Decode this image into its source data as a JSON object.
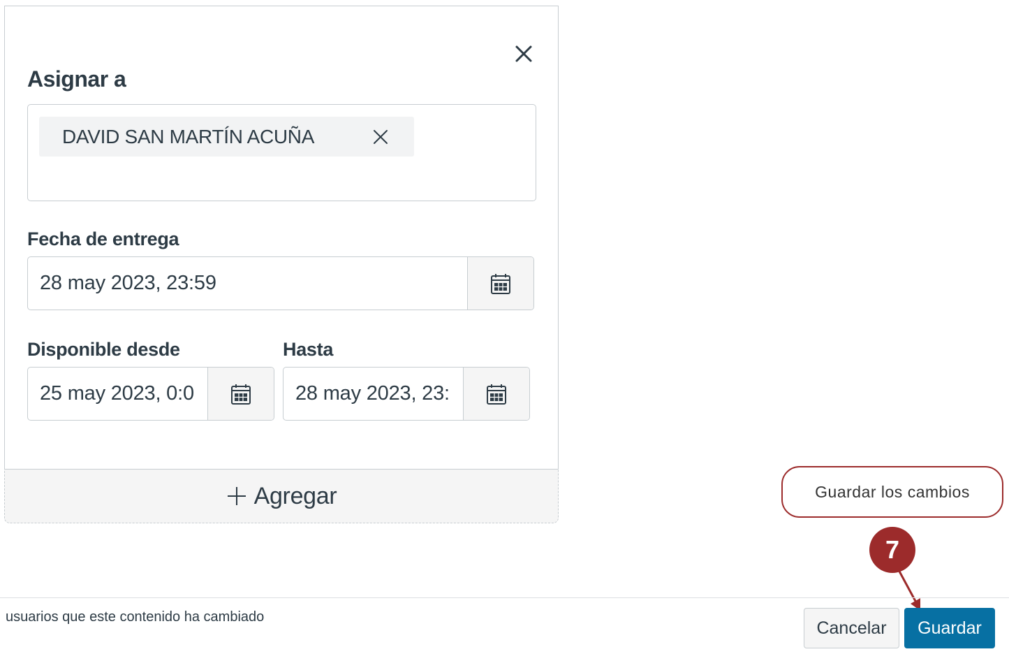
{
  "panel": {
    "title": "Asignar a",
    "assignees": [
      {
        "name": "DAVID SAN MARTÍN ACUÑA"
      }
    ],
    "due": {
      "label": "Fecha de entrega",
      "value": "28 may 2023, 23:59"
    },
    "available_from": {
      "label": "Disponible desde",
      "value": "25 may 2023, 0:0"
    },
    "until": {
      "label": "Hasta",
      "value": "28 may 2023, 23:"
    },
    "add_label": "Agregar"
  },
  "callout": {
    "text": "Guardar los cambios",
    "step": "7",
    "color": "#9c2b2b"
  },
  "footer": {
    "note": "usuarios que este contenido ha cambiado",
    "cancel_label": "Cancelar",
    "save_label": "Guardar",
    "save_color": "#0770a3"
  },
  "icons": {
    "close": "close-icon",
    "calendar": "calendar-icon",
    "plus": "plus-icon"
  }
}
